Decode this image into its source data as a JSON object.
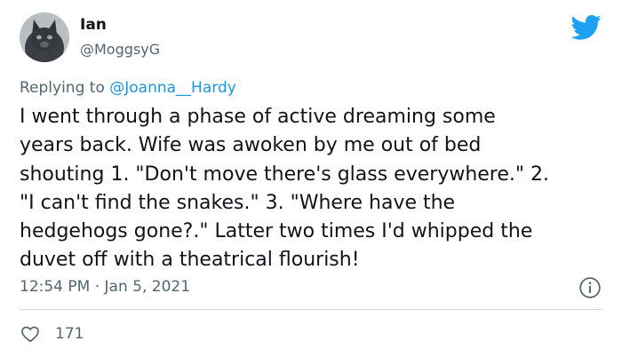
{
  "user": {
    "name": "Ian",
    "handle": "@MoggsyG",
    "avatar_icon": "cat-avatar"
  },
  "reply": {
    "prefix": "Replying to ",
    "mention": "@Joanna__Hardy"
  },
  "tweet": {
    "lines": [
      "I went through a phase of active dreaming some",
      "years back. Wife was awoken by me out of bed",
      "shouting 1. \"Don't move there's glass everywhere.\" 2.",
      "\"I can't find the snakes.\" 3. \"Where have the",
      "hedgehogs gone?.\" Latter two times I'd whipped the",
      "duvet off with a theatrical flourish!"
    ]
  },
  "meta": {
    "timestamp": "12:54 PM · Jan 5, 2021"
  },
  "stats": {
    "likes": "171"
  },
  "colors": {
    "brand": "#1da1f2",
    "mention": "#1b95e0",
    "secondary_text": "#536471",
    "divider": "#cfd9de"
  },
  "icons": {
    "brand": "twitter-bird-icon",
    "info": "info-icon",
    "like": "heart-icon"
  }
}
